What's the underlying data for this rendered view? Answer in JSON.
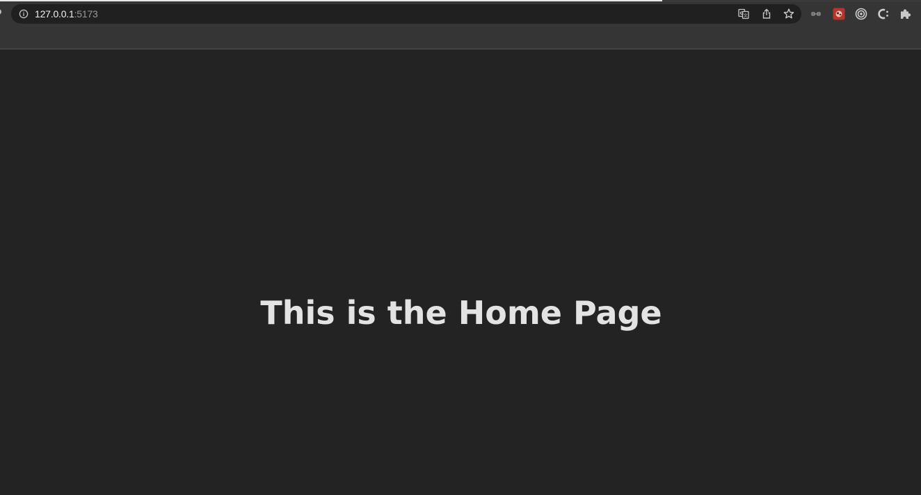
{
  "browser": {
    "address_bar": {
      "host": "127.0.0.1",
      "port": ":5173",
      "icon": "info-icon"
    },
    "omnibox_icons": [
      "translate-icon",
      "share-icon",
      "bookmark-star-icon"
    ],
    "extension_icons": [
      "extension-link-icon",
      "extension-red-icon",
      "extension-target-icon",
      "extension-c-icon",
      "extensions-puzzle-icon"
    ],
    "colors": {
      "page_background": "#232323",
      "toolbar": "#353535",
      "omnibox": "#202020",
      "heading_text": "#e3e3e3"
    }
  },
  "page": {
    "heading": "This is the Home Page"
  }
}
